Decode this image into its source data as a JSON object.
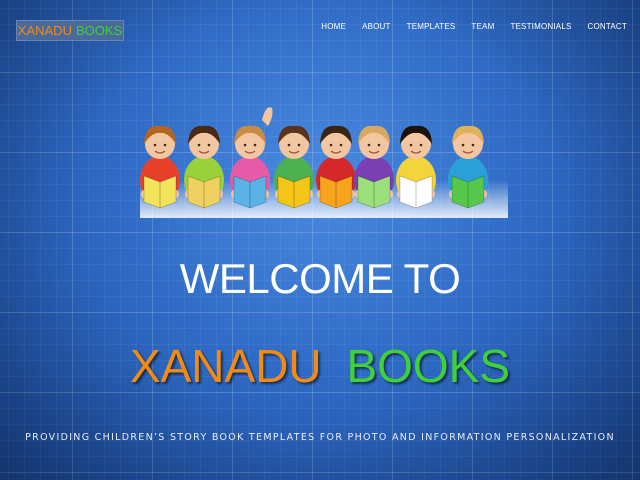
{
  "header": {
    "logo_word1": "XANADU",
    "logo_word2": "BOOKS"
  },
  "nav": {
    "items": [
      "HOME",
      "ABOUT",
      "TEMPLATES",
      "TEAM",
      "TESTIMONIALS",
      "CONTACT"
    ]
  },
  "hero": {
    "welcome": "WELCOME TO",
    "brand_word1": "XANADU",
    "brand_word2": "BOOKS",
    "tagline": "PROVIDING CHILDREN’S STORY BOOK TEMPLATES FOR PHOTO AND INFORMATION PERSONALIZATION"
  },
  "colors": {
    "background": "#2f6bc6",
    "brand_orange": "#f28a16",
    "brand_green": "#3fd13a",
    "text": "#ffffff"
  }
}
